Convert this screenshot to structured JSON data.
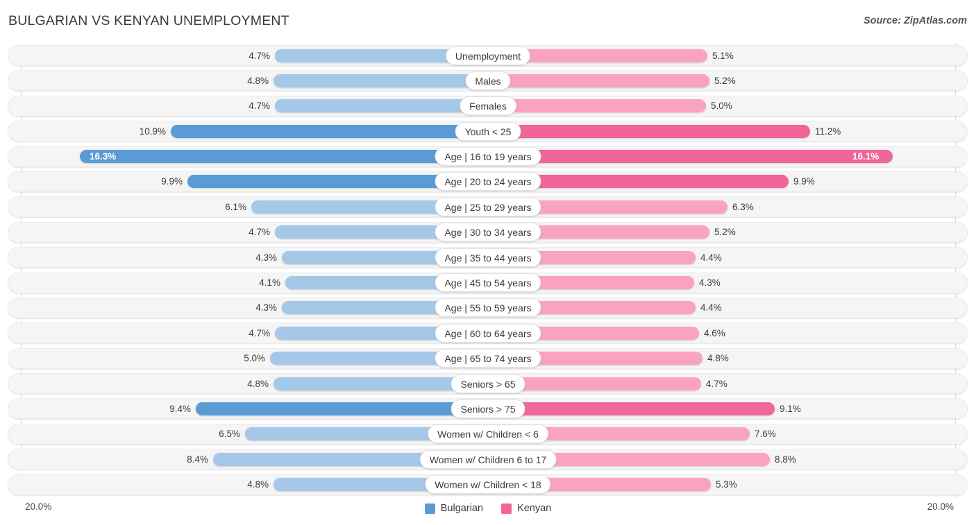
{
  "header": {
    "title": "BULGARIAN VS KENYAN UNEMPLOYMENT",
    "source": "Source: ZipAtlas.com"
  },
  "footer": {
    "axis_min_label": "20.0%",
    "axis_max_label": "20.0%",
    "legend": [
      {
        "label": "Bulgarian",
        "color": "#5b9bd5"
      },
      {
        "label": "Kenyan",
        "color": "#f1669a"
      }
    ]
  },
  "colors": {
    "bulgarian_light": "#a5c8e8",
    "bulgarian_strong": "#5b9bd5",
    "kenyan_light": "#f9a3c0",
    "kenyan_strong": "#f1669a",
    "track": "#f5f5f5",
    "axis": "#d8d8d8"
  },
  "chart_data": {
    "type": "bar",
    "orientation": "horizontal",
    "style": "diverging-bidirectional",
    "title": "BULGARIAN VS KENYAN UNEMPLOYMENT",
    "xlabel": "",
    "ylabel": "",
    "xlim": [
      20.0,
      20.0
    ],
    "axis_max_percent": 20.0,
    "grid": false,
    "legend_position": "bottom-center",
    "categories": [
      "Unemployment",
      "Males",
      "Females",
      "Youth < 25",
      "Age | 16 to 19 years",
      "Age | 20 to 24 years",
      "Age | 25 to 29 years",
      "Age | 30 to 34 years",
      "Age | 35 to 44 years",
      "Age | 45 to 54 years",
      "Age | 55 to 59 years",
      "Age | 60 to 64 years",
      "Age | 65 to 74 years",
      "Seniors > 65",
      "Seniors > 75",
      "Women w/ Children < 6",
      "Women w/ Children 6 to 17",
      "Women w/ Children < 18"
    ],
    "series": [
      {
        "name": "Bulgarian",
        "side": "left",
        "values": [
          4.7,
          4.8,
          4.7,
          10.9,
          16.3,
          9.9,
          6.1,
          4.7,
          4.3,
          4.1,
          4.3,
          4.7,
          5.0,
          4.8,
          9.4,
          6.5,
          8.4,
          4.8
        ],
        "labels": [
          "4.7%",
          "4.8%",
          "4.7%",
          "10.9%",
          "16.3%",
          "9.9%",
          "6.1%",
          "4.7%",
          "4.3%",
          "4.1%",
          "4.3%",
          "4.7%",
          "5.0%",
          "4.8%",
          "9.4%",
          "6.5%",
          "8.4%",
          "4.8%"
        ]
      },
      {
        "name": "Kenyan",
        "side": "right",
        "values": [
          5.1,
          5.2,
          5.0,
          11.2,
          16.1,
          9.9,
          6.3,
          5.2,
          4.4,
          4.3,
          4.4,
          4.6,
          4.8,
          4.7,
          9.1,
          7.6,
          8.8,
          5.3
        ],
        "labels": [
          "5.1%",
          "5.2%",
          "5.0%",
          "11.2%",
          "16.1%",
          "9.9%",
          "6.3%",
          "5.2%",
          "4.4%",
          "4.3%",
          "4.4%",
          "4.6%",
          "4.8%",
          "4.7%",
          "9.1%",
          "7.6%",
          "8.8%",
          "5.3%"
        ]
      }
    ]
  }
}
